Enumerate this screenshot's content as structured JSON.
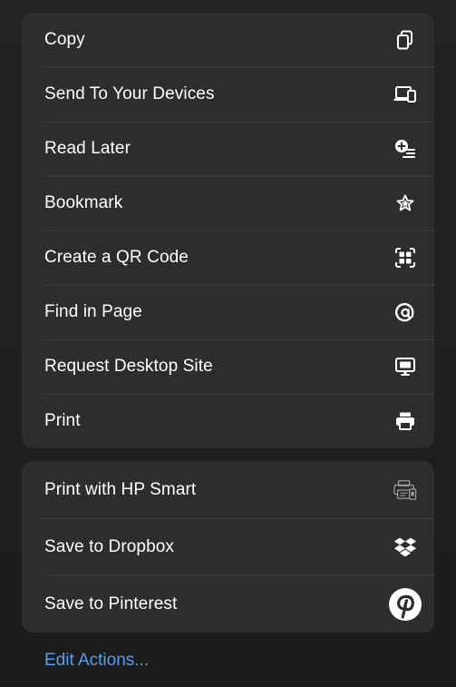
{
  "menu": {
    "primary_actions": [
      {
        "label": "Copy",
        "icon": "copy-icon"
      },
      {
        "label": "Send To Your Devices",
        "icon": "devices-icon"
      },
      {
        "label": "Read Later",
        "icon": "read-later-icon"
      },
      {
        "label": "Bookmark",
        "icon": "star-icon"
      },
      {
        "label": "Create a QR Code",
        "icon": "qr-code-icon"
      },
      {
        "label": "Find in Page",
        "icon": "find-in-page-icon"
      },
      {
        "label": "Request Desktop Site",
        "icon": "desktop-icon"
      },
      {
        "label": "Print",
        "icon": "printer-icon"
      }
    ],
    "extension_actions": [
      {
        "label": "Print with HP Smart",
        "icon": "hp-smart-icon"
      },
      {
        "label": "Save to Dropbox",
        "icon": "dropbox-icon"
      },
      {
        "label": "Save to Pinterest",
        "icon": "pinterest-icon"
      }
    ],
    "edit_actions_label": "Edit Actions..."
  },
  "colors": {
    "background": "#1f1f1f",
    "panel": "#2d2d2e",
    "separator": "#3d3d3f",
    "text": "#ffffff",
    "link": "#5a9ded"
  }
}
